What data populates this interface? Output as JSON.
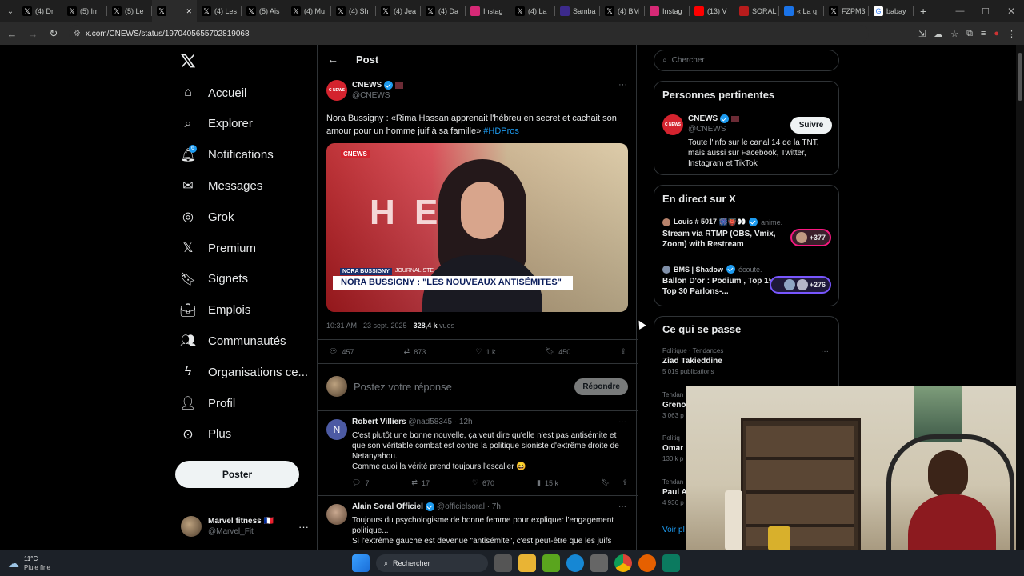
{
  "browser": {
    "tabs": [
      {
        "label": "(4) Dr",
        "icon": "x-icon"
      },
      {
        "label": "(5) Im",
        "icon": "x-icon"
      },
      {
        "label": "(5) Le",
        "icon": "x-icon"
      },
      {
        "label": "",
        "icon": "x-icon",
        "active": true
      },
      {
        "label": "(4) Les",
        "icon": "x-icon"
      },
      {
        "label": "(5) Ais",
        "icon": "x-icon"
      },
      {
        "label": "(4) Mu",
        "icon": "x-icon"
      },
      {
        "label": "(4) Sh",
        "icon": "x-icon"
      },
      {
        "label": "(4) Jea",
        "icon": "x-icon"
      },
      {
        "label": "(4) Da",
        "icon": "x-icon"
      },
      {
        "label": "Instag",
        "icon": "instagram-icon"
      },
      {
        "label": "(4) La",
        "icon": "x-icon"
      },
      {
        "label": "Samba",
        "icon": "samba-icon"
      },
      {
        "label": "(4) BM",
        "icon": "x-icon"
      },
      {
        "label": "Instag",
        "icon": "instagram-icon"
      },
      {
        "label": "(13) V",
        "icon": "youtube-icon"
      },
      {
        "label": "SORAL",
        "icon": "soral-icon"
      },
      {
        "label": "« La q",
        "icon": "doc-icon"
      },
      {
        "label": "FZPM3",
        "icon": "x-icon"
      },
      {
        "label": "babay",
        "icon": "google-icon"
      }
    ],
    "url": "x.com/CNEWS/status/1970405655702819068"
  },
  "sidebar": {
    "items": [
      {
        "label": "Accueil",
        "icon": "home-icon"
      },
      {
        "label": "Explorer",
        "icon": "search-icon"
      },
      {
        "label": "Notifications",
        "icon": "bell-icon",
        "badge": "6"
      },
      {
        "label": "Messages",
        "icon": "mail-icon"
      },
      {
        "label": "Grok",
        "icon": "grok-icon"
      },
      {
        "label": "Premium",
        "icon": "x-logo-icon"
      },
      {
        "label": "Signets",
        "icon": "bookmark-icon"
      },
      {
        "label": "Emplois",
        "icon": "briefcase-icon"
      },
      {
        "label": "Communautés",
        "icon": "people-icon"
      },
      {
        "label": "Organisations ce...",
        "icon": "bolt-icon"
      },
      {
        "label": "Profil",
        "icon": "person-icon"
      },
      {
        "label": "Plus",
        "icon": "more-circle-icon"
      }
    ],
    "post_button": "Poster",
    "account": {
      "name": "Marvel fitness 🇫🇷",
      "handle": "@Marvel_Fit"
    }
  },
  "post": {
    "header": "Post",
    "author": {
      "name": "CNEWS",
      "handle": "@CNEWS"
    },
    "text": "Nora Bussigny : «Rima Hassan apprenait l'hébreu en secret et cachait son amour pour un homme juif à sa famille» ",
    "hashtag": "#HDPros",
    "media": {
      "logo": "CNEWS",
      "name_tag": "NORA BUSSIGNY",
      "role_tag": "JOURNALISTE",
      "headline": "NORA BUSSIGNY : \"LES NOUVEAUX ANTISÉMITES\""
    },
    "time": "10:31 AM · 23 sept. 2025 · ",
    "views": "328,4 k",
    "views_label": " vues",
    "stats": {
      "replies": "457",
      "reposts": "873",
      "likes": "1 k",
      "bookmarks": "450"
    },
    "reply_placeholder": "Postez votre réponse",
    "reply_button": "Répondre"
  },
  "replies": [
    {
      "name": "Robert Villiers",
      "handle": "@nad58345 · 12h",
      "avatar": "N",
      "text": "C'est plutôt une bonne nouvelle, ça veut dire qu'elle n'est pas antisémite et que son véritable combat est contre la politique sioniste d'extrême droite de Netanyahou.\nComme quoi la vérité prend toujours l'escalier 😄",
      "replies": "7",
      "reposts": "17",
      "likes": "670",
      "views": "15 k"
    },
    {
      "name": "Alain Soral Officiel",
      "handle": "@officielsoral · 7h",
      "avatar": "",
      "text": "Toujours du psychologisme de bonne femme pour expliquer l'engagement politique...\nSi l'extrême gauche est devenue \"antisémite\", c'est peut-être que les juifs"
    }
  ],
  "right": {
    "search_placeholder": "Chercher",
    "relevant": {
      "title": "Personnes pertinentes",
      "name": "CNEWS",
      "handle": "@CNEWS",
      "bio": "Toute l'info sur le canal 14 de la TNT, mais aussi sur Facebook, Twitter, Instagram et TikTok",
      "follow": "Suivre"
    },
    "live": {
      "title": "En direct sur X",
      "items": [
        {
          "host": "Louis # 5017 🎆👹👀",
          "status": "anime.",
          "title": "Stream via RTMP (OBS, Vmix, Zoom) with Restream",
          "count": "+377"
        },
        {
          "host": "BMS | Shadow",
          "status": "écoute.",
          "title": "Ballon D'or : Podium , Top 15 Top 30 Parlons-...",
          "count": "+276"
        }
      ]
    },
    "trends": {
      "title": "Ce qui se passe",
      "items": [
        {
          "context": "Politique · Tendances",
          "name": "Ziad Takieddine",
          "count": "5 019 publications"
        },
        {
          "context": "Tendan",
          "name": "Greno",
          "count": "3 063 p"
        },
        {
          "context": "Politiq",
          "name": "Omar",
          "count": "130 k p"
        },
        {
          "context": "Tendan",
          "name": "Paul A",
          "count": "4 936 p"
        }
      ],
      "more": "Voir pl"
    }
  },
  "taskbar": {
    "temp": "11°C",
    "weather": "Pluie fine",
    "search": "Rechercher"
  }
}
